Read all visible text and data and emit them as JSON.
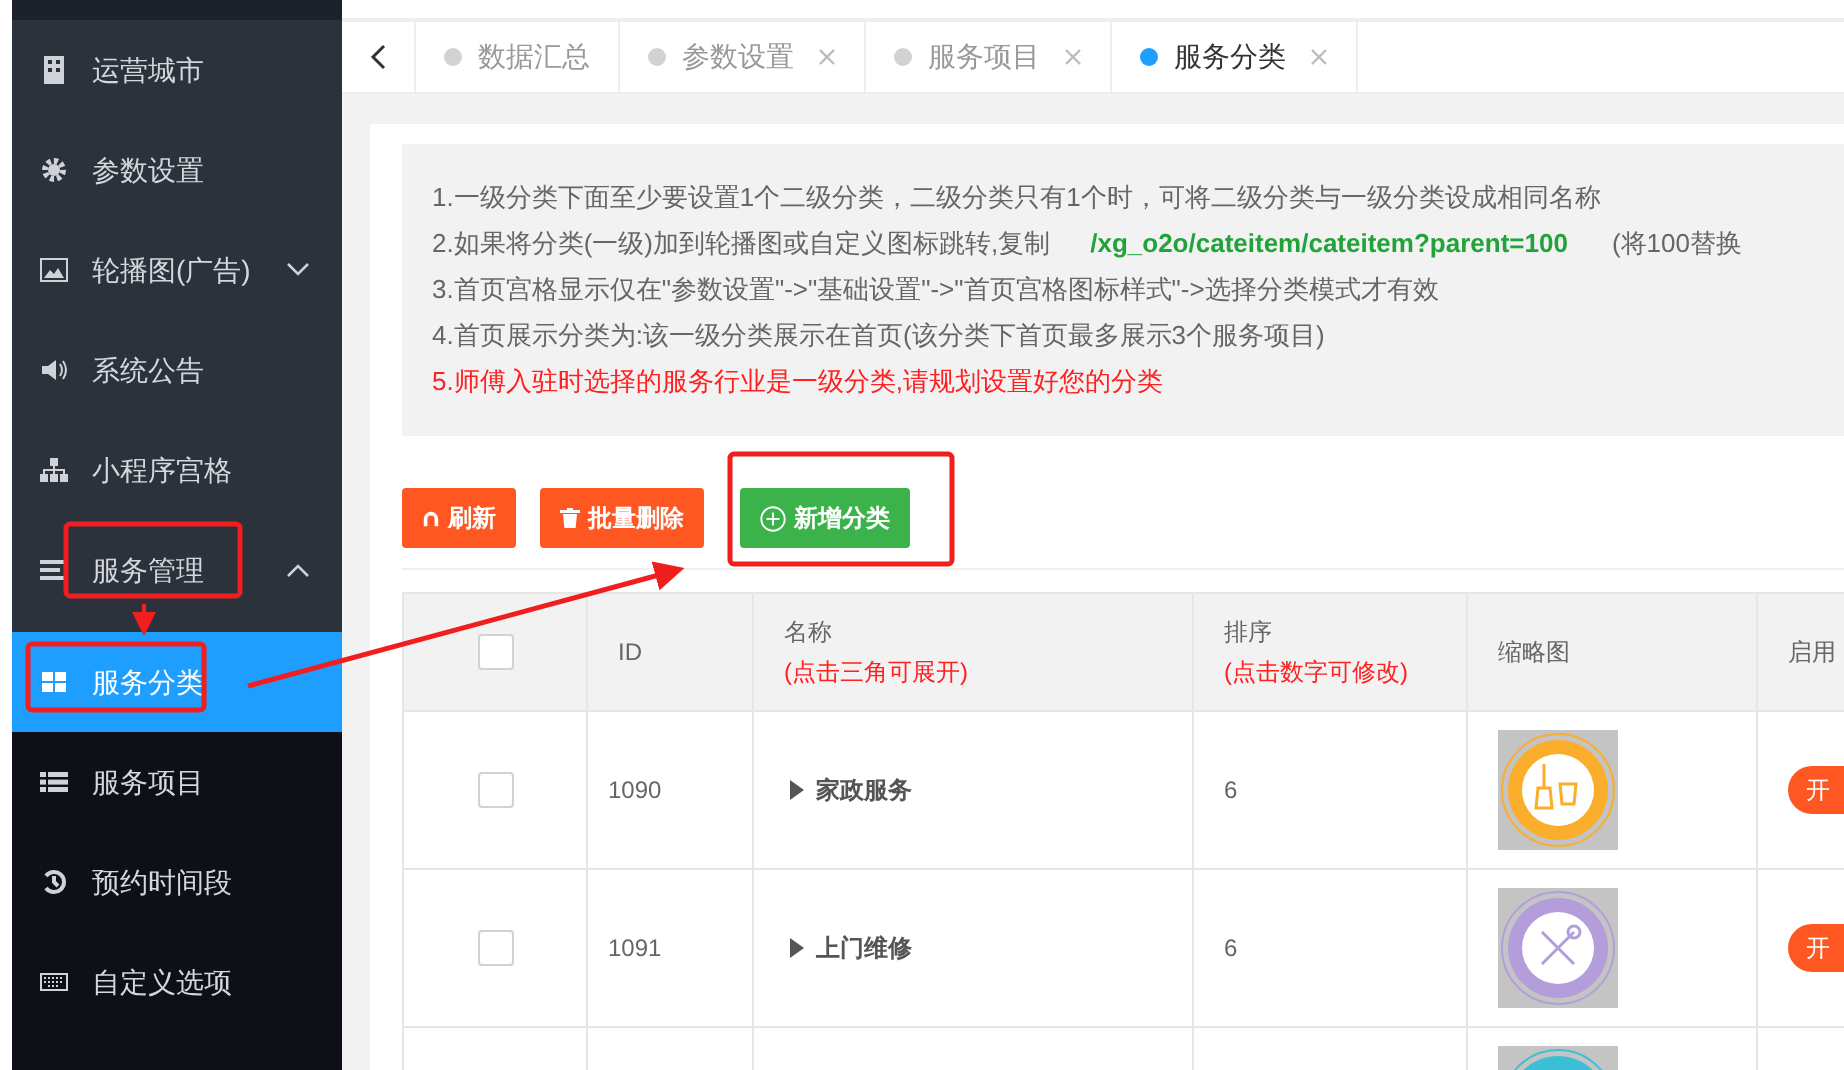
{
  "sidebar": {
    "items": [
      {
        "kind": "item",
        "label": "运营城市",
        "selected": false
      },
      {
        "kind": "item",
        "label": "参数设置",
        "selected": false
      },
      {
        "kind": "group",
        "label": "轮播图(广告)",
        "expanded": false,
        "selected": false
      },
      {
        "kind": "item",
        "label": "系统公告",
        "selected": false
      },
      {
        "kind": "item",
        "label": "小程序宫格",
        "selected": false
      },
      {
        "kind": "group",
        "label": "服务管理",
        "expanded": true,
        "selected": false
      },
      {
        "kind": "subitem",
        "label": "服务分类",
        "selected": true
      },
      {
        "kind": "subitem",
        "label": "服务项目",
        "selected": false
      },
      {
        "kind": "subitem",
        "label": "预约时间段",
        "selected": false
      },
      {
        "kind": "subitem",
        "label": "自定义选项",
        "selected": false
      }
    ]
  },
  "tabs": [
    {
      "label": "数据汇总",
      "selected": false,
      "closable": false
    },
    {
      "label": "参数设置",
      "selected": false,
      "closable": true
    },
    {
      "label": "服务项目",
      "selected": false,
      "closable": true
    },
    {
      "label": "服务分类",
      "selected": true,
      "closable": true
    }
  ],
  "notes": [
    {
      "kind": "plain",
      "text": "1.一级分类下面至少要设置1个二级分类，二级分类只有1个时，可将二级分类与一级分类设成相同名称"
    },
    {
      "kind": "code",
      "text": "2.如果将分类(一级)加到轮播图或自定义图标跳转,复制",
      "code": "/xg_o2o/cateitem/cateitem?parent=100",
      "after": "(将100替换"
    },
    {
      "kind": "plain",
      "text": "3.首页宫格显示仅在\"参数设置\"->\"基础设置\"->\"首页宫格图标样式\"->选择分类模式才有效"
    },
    {
      "kind": "plain",
      "text": "4.首页展示分类为:该一级分类展示在首页(该分类下首页最多展示3个服务项目)"
    },
    {
      "kind": "warning",
      "text": "5.师傅入驻时选择的服务行业是一级分类,请规划设置好您的分类"
    }
  ],
  "toolbar": [
    {
      "label": "刷新",
      "color": "#ff5722"
    },
    {
      "label": "批量删除",
      "color": "#ff5722"
    },
    {
      "label": "新增分类",
      "color": "#3cb34a"
    }
  ],
  "table": {
    "all_checked": false,
    "columns": [
      {
        "label": "ID"
      },
      {
        "label": "名称",
        "hint": "(点击三角可展开)"
      },
      {
        "label": "排序",
        "hint": "(点击数字可修改)"
      },
      {
        "label": "缩略图"
      },
      {
        "label": "启用"
      }
    ],
    "rows": [
      {
        "checked": false,
        "id": "1090",
        "name": "家政服务",
        "sort": "6",
        "color": "#fbae2c",
        "status": "开",
        "on": true
      },
      {
        "checked": false,
        "id": "1091",
        "name": "上门维修",
        "sort": "6",
        "color": "#b39ddb",
        "status": "开",
        "on": true
      },
      {
        "color": "#3bbfd6"
      }
    ]
  }
}
